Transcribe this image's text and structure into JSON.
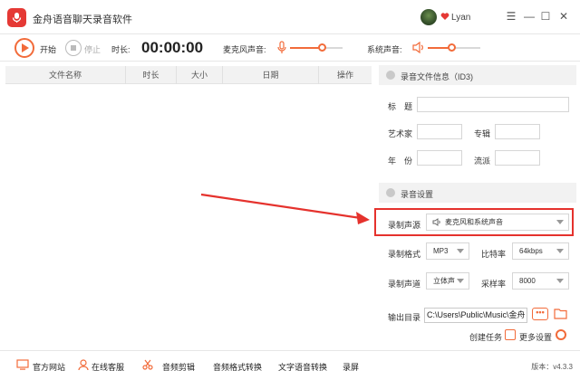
{
  "titlebar": {
    "title": "金舟语音聊天录音软件",
    "username": "Lyan",
    "menu_glyph": "☰",
    "minimize_glyph": "—",
    "maximize_glyph": "☐",
    "close_glyph": "✕"
  },
  "toolbar": {
    "start_label": "开始",
    "stop_label": "停止",
    "duration_label": "时长:",
    "timer": "00:00:00",
    "mic_label": "麦克风声音:",
    "system_label": "系统声音:",
    "mic_volume": 0.6,
    "system_volume": 0.45,
    "accent": "#f26b3a"
  },
  "table": {
    "columns": [
      "文件名称",
      "时长",
      "大小",
      "日期",
      "操作"
    ],
    "rows": []
  },
  "id3": {
    "section_title": "录音文件信息（ID3)",
    "title_label": "标　题",
    "artist_label": "艺术家",
    "album_label": "专辑",
    "year_label": "年　份",
    "genre_label": "流派"
  },
  "settings": {
    "section_title": "录音设置",
    "source_label": "录制声源",
    "source_value": "麦克风和系统声音",
    "format_label": "录制格式",
    "format_value": "MP3",
    "bitrate_label": "比特率",
    "bitrate_value": "64kbps",
    "channel_label": "录制声道",
    "channel_value": "立体声",
    "samplerate_label": "采样率",
    "samplerate_value": "8000",
    "output_label": "输出目录",
    "output_path": "C:\\Users\\Public\\Music\\金舟",
    "dots_label": "•••",
    "create_task_label": "创建任务",
    "more_settings_label": "更多设置"
  },
  "bottombar": {
    "items": [
      "官方网站",
      "在线客服",
      "音频剪辑",
      "音频格式转换",
      "文字语音转换",
      "录屏"
    ],
    "version": "版本：v4.3.3"
  },
  "colors": {
    "accent": "#f26b3a",
    "highlight": "#e5322d",
    "logo": "#e53935"
  }
}
